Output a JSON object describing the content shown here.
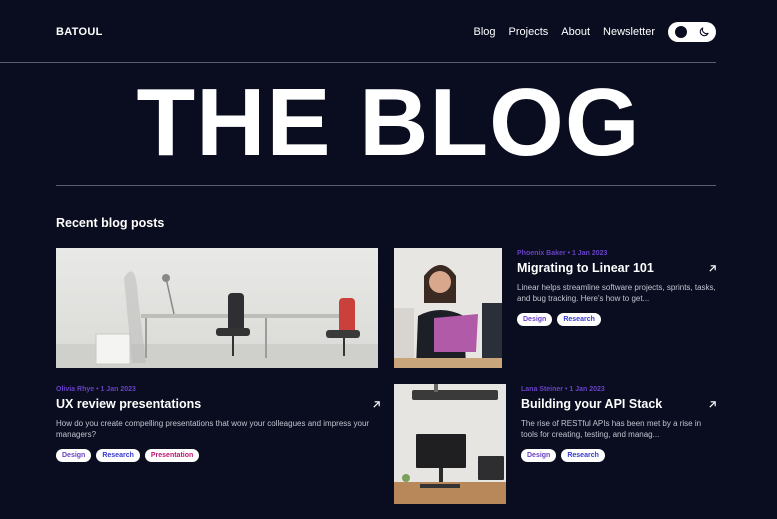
{
  "header": {
    "brand": "BATOUL",
    "nav": [
      "Blog",
      "Projects",
      "About",
      "Newsletter"
    ]
  },
  "hero": {
    "title": "THE BLOG"
  },
  "section": {
    "title": "Recent blog posts"
  },
  "posts": [
    {
      "meta": "Olivia Rhye • 1 Jan 2023",
      "title": "UX review presentations",
      "desc": "How do you create compelling presentations that wow your colleagues and impress your managers?",
      "tags": [
        "Design",
        "Research",
        "Presentation"
      ]
    },
    {
      "meta": "Phoenix Baker • 1 Jan 2023",
      "title": "Migrating to Linear 101",
      "desc": "Linear helps streamline software projects, sprints, tasks, and bug tracking. Here's how to get...",
      "tags": [
        "Design",
        "Research"
      ]
    },
    {
      "meta": "Lana Steiner • 1 Jan 2023",
      "title": "Building your API Stack",
      "desc": "The rise of RESTful APIs has been met by a rise in tools for creating, testing, and manag...",
      "tags": [
        "Design",
        "Research"
      ]
    }
  ],
  "icons": {
    "arrow": "arrow-up-right-icon",
    "theme_toggle": "moon-icon"
  },
  "colors": {
    "background": "#090d1f",
    "accent": "#6941c6",
    "tag_blue": "#3538cd",
    "tag_pink": "#c11574"
  }
}
